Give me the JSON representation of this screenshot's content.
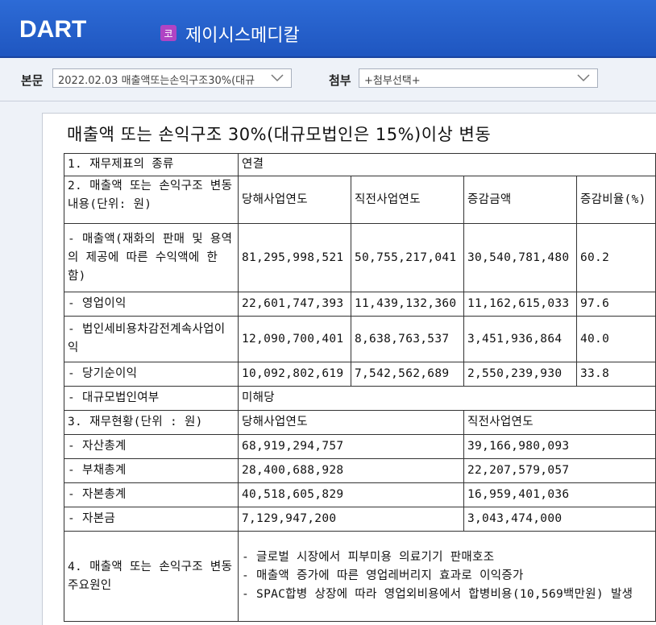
{
  "header": {
    "logo": "DART",
    "market_badge": "코",
    "company_name": "제이시스메디칼"
  },
  "selector": {
    "body_label": "본문",
    "body_value": "2022.02.03  매출액또는손익구조30%(대규",
    "attach_label": "첨부",
    "attach_value": "+첨부선택+"
  },
  "document": {
    "title": "매출액 또는 손익구조 30%(대규모법인은 15%)이상 변동",
    "s1_label": "1. 재무제표의 종류",
    "s1_value": "연결",
    "s2_label": "2. 매출액 또는 손익구조 변동내용(단위: 원)",
    "s2_headers": [
      "당해사업연도",
      "직전사업연도",
      "증감금액",
      "증감비율(%)"
    ],
    "s2_rows": [
      {
        "label": "- 매출액(재화의 판매 및 용역의 제공에 따른 수익액에 한함)",
        "values": [
          "81,295,998,521",
          "50,755,217,041",
          "30,540,781,480",
          "60.2"
        ]
      },
      {
        "label": "- 영업이익",
        "values": [
          "22,601,747,393",
          "11,439,132,360",
          "11,162,615,033",
          "97.6"
        ]
      },
      {
        "label": "- 법인세비용차감전계속사업이익",
        "values": [
          "12,090,700,401",
          "8,638,763,537",
          "3,451,936,864",
          "40.0"
        ]
      },
      {
        "label": "- 당기순이익",
        "values": [
          "10,092,802,619",
          "7,542,562,689",
          "2,550,239,930",
          "33.8"
        ]
      }
    ],
    "large_corp_label": "- 대규모법인여부",
    "large_corp_value": "미해당",
    "s3_label": "3. 재무현황(단위 : 원)",
    "s3_headers": [
      "당해사업연도",
      "직전사업연도"
    ],
    "s3_rows": [
      {
        "label": "- 자산총계",
        "values": [
          "68,919,294,757",
          "39,166,980,093"
        ]
      },
      {
        "label": "- 부채총계",
        "values": [
          "28,400,688,928",
          "22,207,579,057"
        ]
      },
      {
        "label": "- 자본총계",
        "values": [
          "40,518,605,829",
          "16,959,401,036"
        ]
      },
      {
        "label": "- 자본금",
        "values": [
          "7,129,947,200",
          "3,043,474,000"
        ]
      }
    ],
    "s4_label": "4. 매출액 또는 손익구조 변동 주요원인",
    "s4_lines": [
      "- 글로벌 시장에서 피부미용 의료기기 판매호조",
      "- 매출액 증가에 따른 영업레버리지 효과로 이익증가",
      "- SPAC합병 상장에 따라 영업외비용에서 합병비용(10,569백만원) 발생"
    ]
  },
  "colors": {
    "header_blue": "#1f56c0",
    "badge_purple": "#b044c4",
    "page_bg": "#eef2f8"
  }
}
